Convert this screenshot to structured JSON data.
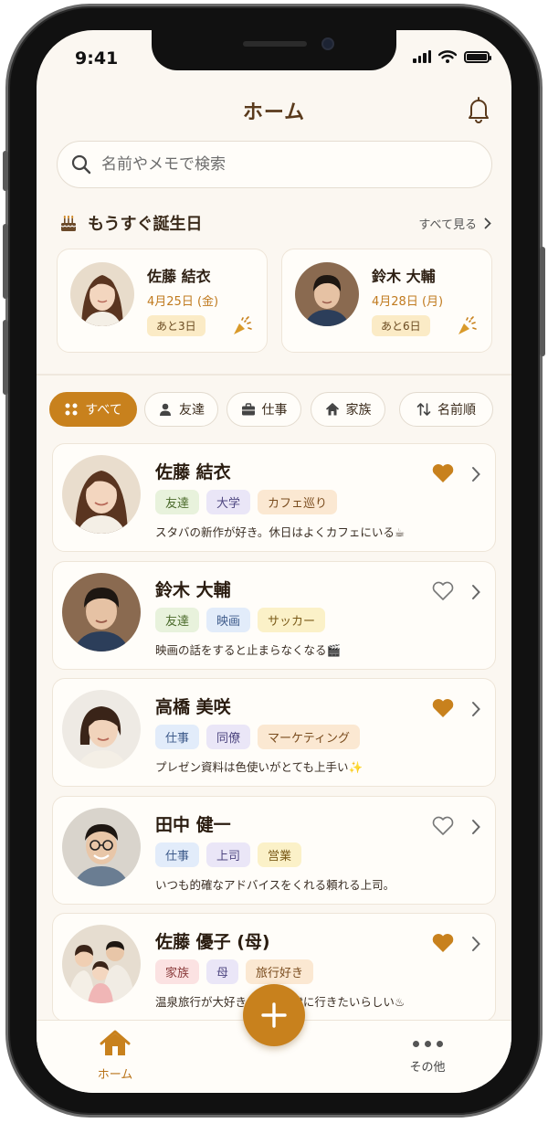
{
  "status_bar": {
    "time": "9:41"
  },
  "header": {
    "title": "ホーム"
  },
  "search": {
    "placeholder": "名前やメモで検索"
  },
  "birthdays": {
    "title": "もうすぐ誕生日",
    "see_all": "すべて見る",
    "cards": [
      {
        "name": "佐藤 結衣",
        "date": "4月25日 (金)",
        "countdown": "あと3日"
      },
      {
        "name": "鈴木 大輔",
        "date": "4月28日 (月)",
        "countdown": "あと6日"
      }
    ]
  },
  "filters": [
    {
      "label": "すべて",
      "icon": "grid-icon",
      "active": true
    },
    {
      "label": "友達",
      "icon": "person-icon",
      "active": false
    },
    {
      "label": "仕事",
      "icon": "briefcase-icon",
      "active": false
    },
    {
      "label": "家族",
      "icon": "house-icon",
      "active": false
    },
    {
      "label": "名前順",
      "icon": "sort-icon",
      "active": false
    }
  ],
  "contacts": [
    {
      "name": "佐藤 結衣",
      "tags": [
        "友達",
        "大学",
        "カフェ巡り"
      ],
      "note": "スタバの新作が好き。休日はよくカフェにいる☕",
      "favorite": true
    },
    {
      "name": "鈴木 大輔",
      "tags": [
        "友達",
        "映画",
        "サッカー"
      ],
      "note": "映画の話をすると止まらなくなる🎬",
      "favorite": false
    },
    {
      "name": "高橋 美咲",
      "tags": [
        "仕事",
        "同僚",
        "マーケティング"
      ],
      "note": "プレゼン資料は色使いがとても上手い✨",
      "favorite": true
    },
    {
      "name": "田中 健一",
      "tags": [
        "仕事",
        "上司",
        "営業"
      ],
      "note": "いつも的確なアドバイスをくれる頼れる上司。",
      "favorite": false
    },
    {
      "name": "佐藤 優子 (母)",
      "tags": [
        "家族",
        "母",
        "旅行好き"
      ],
      "note": "温泉旅行が大好き。次は草津に行きたいらしい♨",
      "favorite": true
    }
  ],
  "bottom_nav": {
    "home": "ホーム",
    "more": "その他"
  },
  "colors": {
    "accent": "#c8811d",
    "background": "#fbf7f1"
  }
}
